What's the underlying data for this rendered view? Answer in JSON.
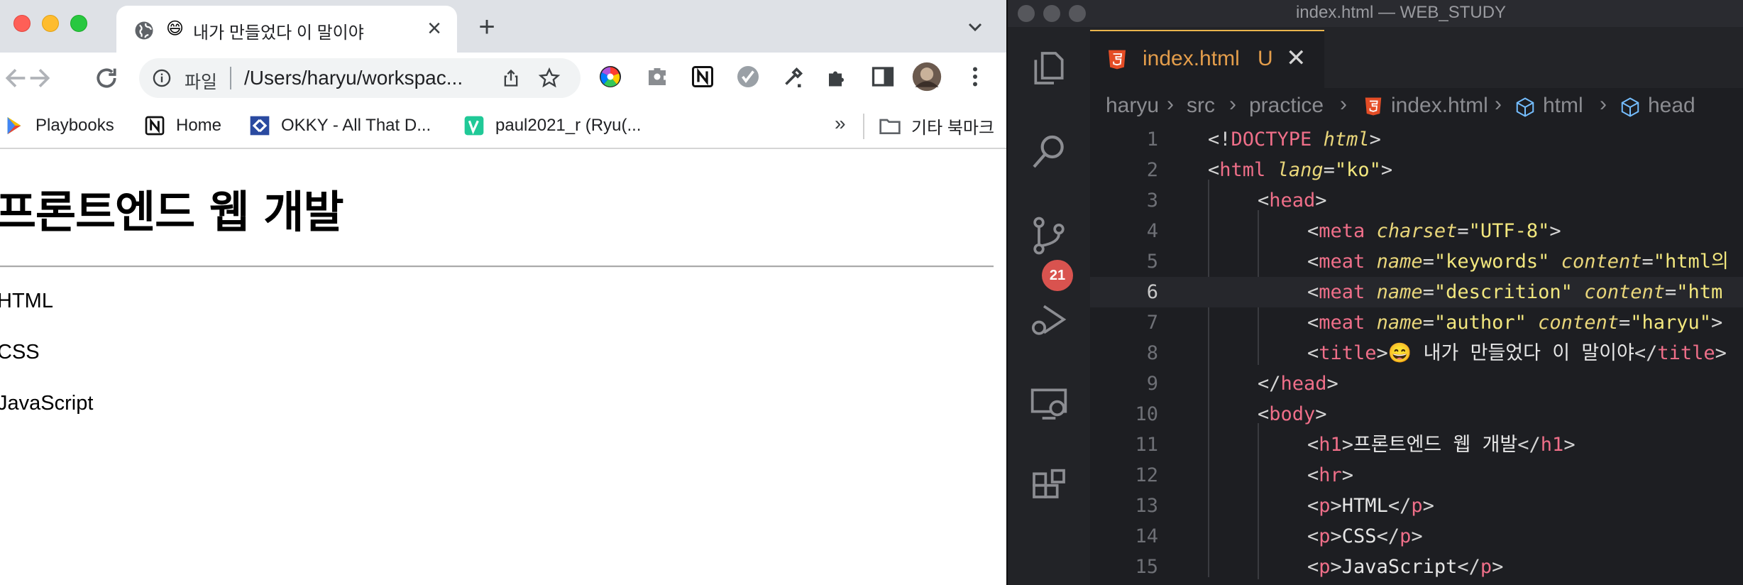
{
  "browser": {
    "tab": {
      "emoji": "😄",
      "title": "내가 만들었다 이 말이야"
    },
    "address": {
      "scheme_label": "파일",
      "url": "/Users/haryu/workspac..."
    },
    "bookmarks": [
      {
        "label": "Playbooks"
      },
      {
        "label": "Home"
      },
      {
        "label": "OKKY - All That D..."
      },
      {
        "label": "paul2021_r (Ryu(..."
      }
    ],
    "bookmarks_overflow": "»",
    "other_bookmarks": "기타 북마크",
    "page": {
      "heading": "프론트엔드 웹 개발",
      "paragraphs": [
        "HTML",
        "CSS",
        "JavaScript"
      ]
    }
  },
  "vscode": {
    "window_title": "index.html — WEB_STUDY",
    "scm_badge": "21",
    "tab": {
      "name": "index.html",
      "status": "U"
    },
    "breadcrumbs": [
      "haryu",
      "src",
      "practice",
      "index.html",
      "html",
      "head"
    ],
    "current_line": 6,
    "lines": [
      {
        "n": "1"
      },
      {
        "n": "2"
      },
      {
        "n": "3"
      },
      {
        "n": "4"
      },
      {
        "n": "5"
      },
      {
        "n": "6"
      },
      {
        "n": "7"
      },
      {
        "n": "8"
      },
      {
        "n": "9"
      },
      {
        "n": "10"
      },
      {
        "n": "11"
      },
      {
        "n": "12"
      },
      {
        "n": "13"
      },
      {
        "n": "14"
      },
      {
        "n": "15"
      }
    ],
    "code": {
      "l1": {
        "a": "<!",
        "b": "DOCTYPE",
        "c": " ",
        "d": "html",
        "e": ">"
      },
      "l2": {
        "a": "<",
        "b": "html",
        "c": " ",
        "d": "lang",
        "e": "=",
        "f": "\"ko\"",
        "g": ">"
      },
      "l3": {
        "a": "<",
        "b": "head",
        "c": ">"
      },
      "l4": {
        "a": "<",
        "b": "meta",
        "c": " ",
        "d": "charset",
        "e": "=",
        "f": "\"UTF-8\"",
        "g": ">"
      },
      "l5": {
        "a": "<",
        "b": "meat",
        "c": " ",
        "d": "name",
        "e": "=",
        "f": "\"keywords\"",
        "g": " ",
        "h": "content",
        "i": "=",
        "j": "\"html의"
      },
      "l6": {
        "a": "<",
        "b": "meat",
        "c": " ",
        "d": "name",
        "e": "=",
        "f": "\"descrition\"",
        "g": " ",
        "h": "content",
        "i": "=",
        "j": "\"htm"
      },
      "l7": {
        "a": "<",
        "b": "meat",
        "c": " ",
        "d": "name",
        "e": "=",
        "f": "\"author\"",
        "g": " ",
        "h": "content",
        "i": "=",
        "j": "\"haryu\"",
        "k": ">"
      },
      "l8": {
        "a": "<",
        "b": "title",
        "c": ">",
        "d": "😄 내가 만들었다 이 말이야",
        "e": "</",
        "f": "title",
        "g": ">"
      },
      "l9": {
        "a": "</",
        "b": "head",
        "c": ">"
      },
      "l10": {
        "a": "<",
        "b": "body",
        "c": ">"
      },
      "l11": {
        "a": "<",
        "b": "h1",
        "c": ">",
        "d": "프론트엔드 웹 개발",
        "e": "</",
        "f": "h1",
        "g": ">"
      },
      "l12": {
        "a": "<",
        "b": "hr",
        "c": ">"
      },
      "l13": {
        "a": "<",
        "b": "p",
        "c": ">",
        "d": "HTML",
        "e": "</",
        "f": "p",
        "g": ">"
      },
      "l14": {
        "a": "<",
        "b": "p",
        "c": ">",
        "d": "CSS",
        "e": "</",
        "f": "p",
        "g": ">"
      },
      "l15": {
        "a": "<",
        "b": "p",
        "c": ">",
        "d": "JavaScript",
        "e": "</",
        "f": "p",
        "g": ">"
      }
    }
  },
  "colors": {
    "chrome_tabstrip": "#dee1e6",
    "vscode_bg": "#1e1f22",
    "tag": "#ef6f89",
    "attribute": "#e9d67a",
    "string": "#f2e77e",
    "modified_file": "#e39d4b",
    "badge": "#d9534f"
  },
  "icons": {
    "browser": [
      "globe-icon",
      "close-icon",
      "plus-icon",
      "chevron-down-icon",
      "back-icon",
      "forward-icon",
      "reload-icon",
      "info-icon",
      "share-icon",
      "star-icon",
      "color-wheel-icon",
      "extension-icon",
      "notion-icon",
      "check-icon",
      "eyedropper-icon",
      "puzzle-icon",
      "sidepanel-icon",
      "avatar",
      "more-icon",
      "folder-icon"
    ],
    "vscode": [
      "files-icon",
      "search-icon",
      "source-control-icon",
      "run-debug-icon",
      "remote-explorer-icon",
      "extensions-icon",
      "html5-icon",
      "cube-icon"
    ]
  }
}
